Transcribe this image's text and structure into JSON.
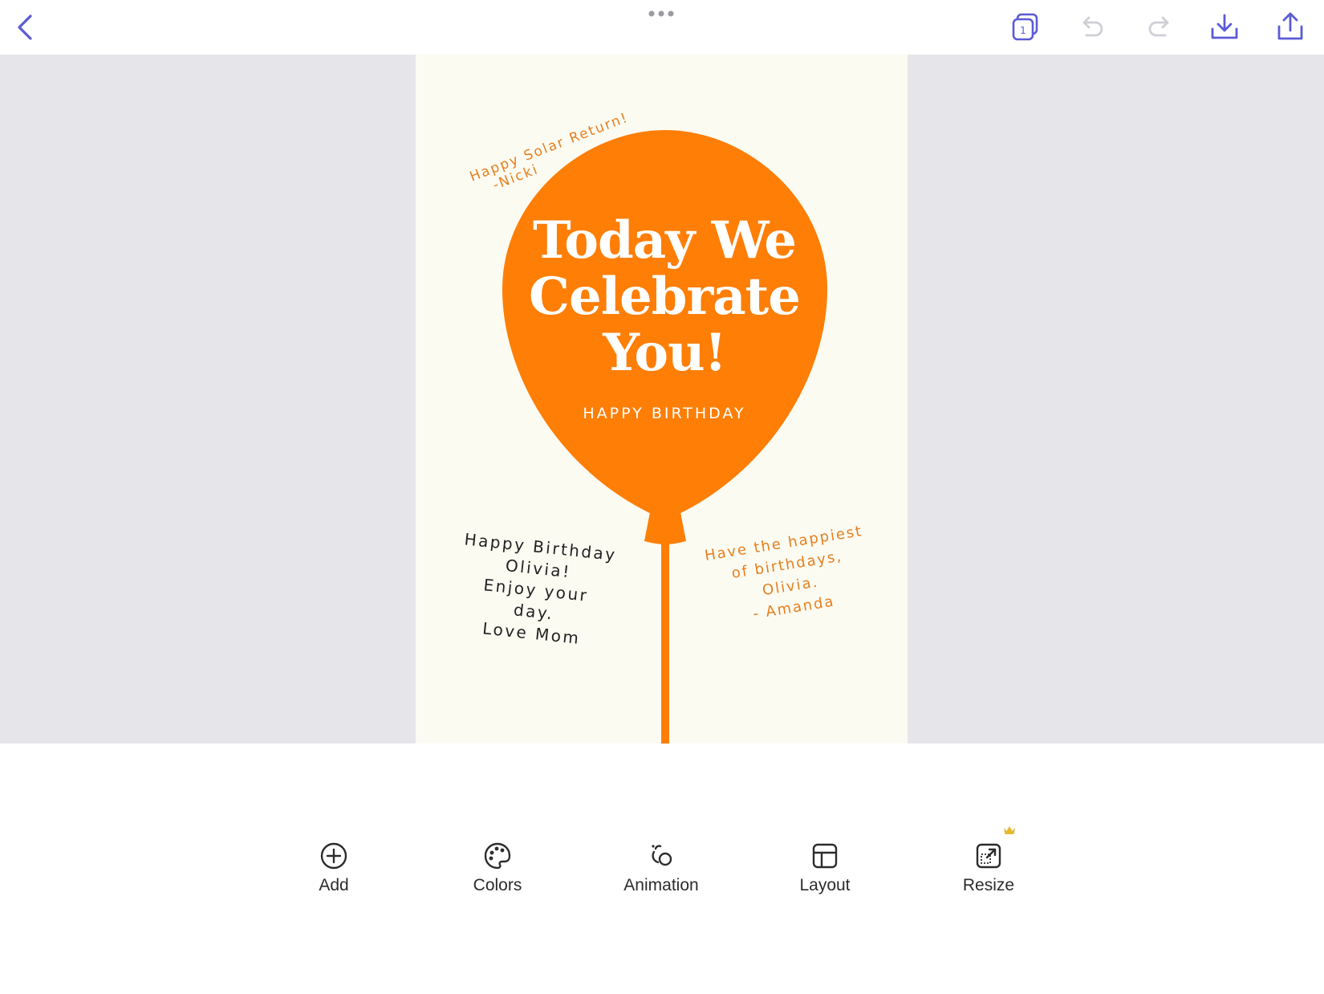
{
  "header": {
    "back_icon": "chevron-left-icon",
    "more_icon": "more-dots-icon",
    "pages_badge": "1",
    "actions": [
      "pages-icon",
      "undo-icon",
      "redo-icon",
      "download-icon",
      "share-icon"
    ]
  },
  "colors": {
    "accent": "#5b5bd6",
    "balloon": "#ff7e06",
    "card_background": "#fcfbf2",
    "canvas_background": "#e6e6ea",
    "note_orange": "#e67f1e",
    "premium_crown": "#e5b82d"
  },
  "card": {
    "title_lines": [
      "Today We",
      "Celebrate",
      "You!"
    ],
    "subtitle": "HAPPY BIRTHDAY",
    "note_nicki": [
      "Happy Solar Return!",
      "-Nicki"
    ],
    "note_mom": [
      "Happy Birthday",
      "Olivia!",
      "Enjoy your",
      "day.",
      "Love Mom"
    ],
    "note_amanda": [
      "Have the happiest",
      "of birthdays,",
      "Olivia.",
      "- Amanda"
    ]
  },
  "toolbar": {
    "add": "Add",
    "colors": "Colors",
    "animation": "Animation",
    "layout": "Layout",
    "resize": "Resize",
    "resize_badge": "premium-crown-icon"
  }
}
